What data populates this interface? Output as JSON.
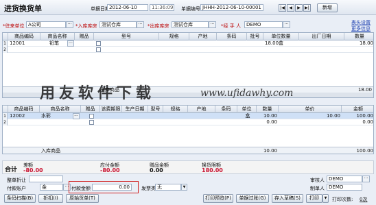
{
  "title": "进货换货单",
  "header": {
    "date_label": "单据日期",
    "date_value": "2012-06-10",
    "time_value": "11:36:09",
    "doc_no_label": "单据编号",
    "doc_no_value": "JHHH-2012-06-10-00001",
    "add_label": "新增",
    "nav": [
      "|◀",
      "◀",
      "▶",
      "▶|"
    ]
  },
  "form": {
    "vendor_label": "*往来单位",
    "vendor_value": "A公司",
    "in_wh_label": "*入库库房",
    "in_wh_value": "测试仓库",
    "out_wh_label": "*出库库房",
    "out_wh_value": "测试仓库",
    "handler_label": "*经 手 人",
    "handler_value": "DEMO",
    "dots": "···",
    "link_table_settings": "表头设置",
    "link_more_info": "更多信息"
  },
  "out_grid": {
    "columns": [
      "",
      "商品编码",
      "商品名称",
      "赠品",
      "型号",
      "规格",
      "产地",
      "条码",
      "批号",
      "单位数量",
      "出厂日期",
      "数量"
    ],
    "rows": [
      {
        "num": "1",
        "code": "12001",
        "name": "铅笔",
        "unit_qty": "18.00盒",
        "qty": "18.00"
      },
      {
        "num": "2",
        "code": "",
        "name": "",
        "unit_qty": "",
        "qty": ""
      }
    ],
    "section_label": "出库商品",
    "total_qty": "18.00"
  },
  "in_grid": {
    "columns": [
      "",
      "商品编码",
      "商品名称",
      "赠品",
      "该费期限",
      "生产日期",
      "型号",
      "规格",
      "产地",
      "条码",
      "单位",
      "数量",
      "单价",
      "金额"
    ],
    "rows": [
      {
        "num": "1",
        "code": "12002",
        "name": "水彩",
        "unit": "盒",
        "qty": "10.00",
        "price": "10.00",
        "amount": "100.00"
      },
      {
        "num": "2",
        "code": "",
        "name": "",
        "unit": "",
        "qty": "0.00",
        "price": "",
        "amount": "0.00"
      }
    ],
    "section_label": "入库商品",
    "total_qty": "10.00",
    "total_amount": "100.00"
  },
  "summary": {
    "label": "合计",
    "diff_label": "差额",
    "diff_value": "-80.00",
    "payable_label": "应付金额",
    "payable_value": "-80.00",
    "gift_label": "赠品金额",
    "gift_value": "0.00",
    "exchange_label": "换货限额",
    "exchange_value": "180.00"
  },
  "footer_form": {
    "discount_label": "整单折让",
    "pay_account_label": "付款账户",
    "pay_account_value": "金",
    "pay_amount_label": "付款金额",
    "pay_amount_value": "0.00",
    "invoice_label": "发票类型",
    "invoice_value": "无",
    "auditor_label": "审核人",
    "auditor_value": "DEMO",
    "maker_label": "制单人",
    "maker_value": "DEMO"
  },
  "buttons": {
    "scan": "条码扫描(B)",
    "discount": "折扣(I)",
    "return": "原始货单(T)",
    "print_preview": "打印预览(P)",
    "save_print": "单据过账(G)",
    "save_draft": "存入草稿(S)",
    "print": "打印",
    "print_count_label": "打印次数:",
    "print_count_value": "0次"
  },
  "watermark": {
    "cn": "用友软件下载",
    "url": "www.ufidawhy.com"
  }
}
